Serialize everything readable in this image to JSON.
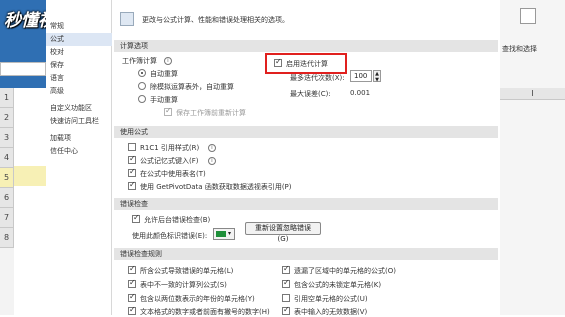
{
  "logo_text": "秒懂视频",
  "spreadsheet": {
    "row_numbers": [
      "1",
      "2",
      "3",
      "4",
      "5",
      "6",
      "7",
      "8"
    ],
    "right_tool_label": "查找和选择",
    "col_header": "I"
  },
  "nav": {
    "items": [
      {
        "label": "常规"
      },
      {
        "label": "公式"
      },
      {
        "label": "校对"
      },
      {
        "label": "保存"
      },
      {
        "label": "语言"
      },
      {
        "label": "高级"
      },
      {
        "label": "自定义功能区"
      },
      {
        "label": "快速访问工具栏"
      },
      {
        "label": "加载项"
      },
      {
        "label": "信任中心"
      }
    ],
    "selected": "公式"
  },
  "header": {
    "text": "更改与公式计算、性能和错误处理相关的选项。"
  },
  "calc": {
    "section_title": "计算选项",
    "workbook_calc_label": "工作簿计算",
    "auto": "自动重算",
    "auto_except": "除模拟运算表外，自动重算",
    "manual": "手动重算",
    "recalc_on_save": "保存工作簿前重新计算",
    "iterative": "启用迭代计算",
    "max_iter_label": "最多迭代次数(X):",
    "max_iter_value": "100",
    "max_change_label": "最大误差(C):",
    "max_change_value": "0.001"
  },
  "formulas": {
    "section_title": "使用公式",
    "items": [
      {
        "label": "R1C1 引用样式(R)",
        "checked": false
      },
      {
        "label": "公式记忆式键入(F)",
        "checked": true
      },
      {
        "label": "在公式中使用表名(T)",
        "checked": true
      },
      {
        "label": "使用 GetPivotData 函数获取数据透视表引用(P)",
        "checked": true
      }
    ]
  },
  "error_check": {
    "section_title": "错误检查",
    "enable_bg": "允许后台错误检查(B)",
    "color_label": "使用此颜色标识错误(E):",
    "reset_button": "重新设置忽略错误(G)"
  },
  "rules": {
    "section_title": "错误检查规则",
    "left": [
      {
        "label": "所含公式导致错误的单元格(L)",
        "checked": true
      },
      {
        "label": "表中不一致的计算列公式(S)",
        "checked": true
      },
      {
        "label": "包含以两位数表示的年份的单元格(Y)",
        "checked": true
      },
      {
        "label": "文本格式的数字或者前面有撇号的数字(H)",
        "checked": true
      }
    ],
    "right": [
      {
        "label": "遗漏了区域中的单元格的公式(O)",
        "checked": true
      },
      {
        "label": "包含公式的未锁定单元格(K)",
        "checked": true
      },
      {
        "label": "引用空单元格的公式(U)",
        "checked": false
      },
      {
        "label": "表中输入的无效数据(V)",
        "checked": true
      }
    ]
  }
}
